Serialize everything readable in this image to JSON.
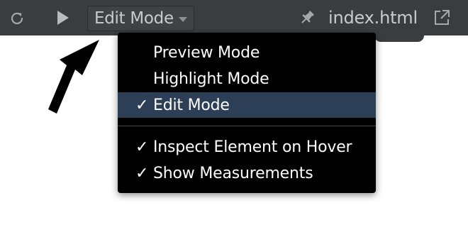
{
  "toolbar": {
    "reload_icon": "reload-icon",
    "play_icon": "play-icon",
    "mode_select": {
      "selected": "Edit Mode"
    },
    "pin_icon": "pin-icon",
    "filename": "index.html",
    "external_icon": "open-external-icon"
  },
  "menu": {
    "items": [
      {
        "label": "Preview Mode",
        "checked": false,
        "selected": false
      },
      {
        "label": "Highlight Mode",
        "checked": false,
        "selected": false
      },
      {
        "label": "Edit Mode",
        "checked": true,
        "selected": true,
        "check": "✓"
      }
    ],
    "options": [
      {
        "label": "Inspect Element on Hover",
        "checked": true,
        "check": "✓"
      },
      {
        "label": "Show Measurements",
        "checked": true,
        "check": "✓"
      }
    ]
  },
  "colors": {
    "toolbar_bg": "#3a3d3f",
    "menu_bg": "#000000",
    "menu_selected_bg": "#2c3f57",
    "toolbar_text": "#c9cbcd"
  }
}
